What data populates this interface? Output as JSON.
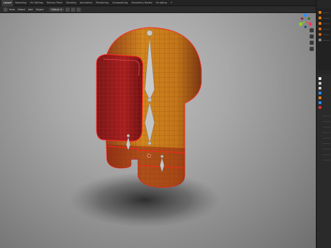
{
  "app": "Blender",
  "workspace_tabs": [
    "Layout",
    "Modeling",
    "UV Editing",
    "Texture Paint",
    "Shading",
    "Animation",
    "Rendering",
    "Compositing",
    "Geometry Nodes",
    "Scripting",
    "+"
  ],
  "active_tab_index": 0,
  "header": {
    "menus": [
      "View",
      "Select",
      "Add",
      "Object"
    ],
    "orientation_label": "Global"
  },
  "colors": {
    "accent": "#e87d0d",
    "body_orange": "#d9861f",
    "visor_red": "#9c1c1c",
    "edge_red": "#ff2020",
    "bone_gray": "#c8c8c8",
    "gizmo_x": "#ff3352",
    "gizmo_y": "#8bdc00",
    "gizmo_z": "#2890ff"
  },
  "gizmo": {
    "axis_labels": [
      "X",
      "Y",
      "Z"
    ]
  },
  "icons": [
    "move-gizmo-icon",
    "camera-icon",
    "hand-pan-icon",
    "grid-icon",
    "object-properties-icon",
    "modifier-icon",
    "material-icon"
  ]
}
